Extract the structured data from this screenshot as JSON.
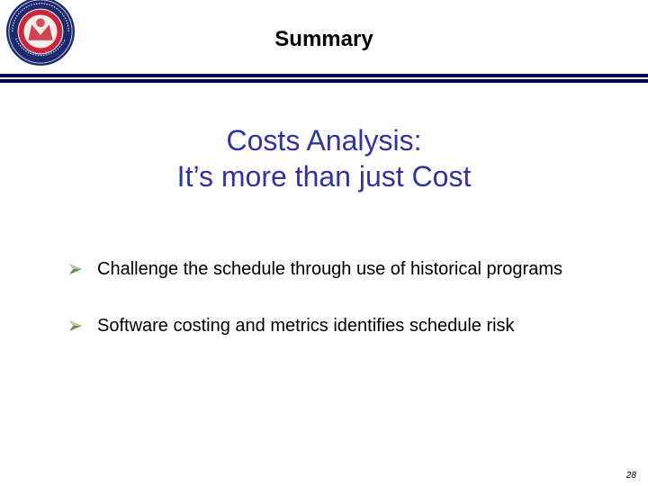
{
  "header": {
    "logo_icon": "army-seal-logo",
    "logo_text": "OFFICE OF THE ASSISTANT SECRETARY OF THE ARMY",
    "title": "Summary"
  },
  "colors": {
    "rule": "#000050",
    "subtitle": "#3333a0",
    "bullet_arrow": "#6f8f4f"
  },
  "slide": {
    "subtitle_line1": "Costs Analysis:",
    "subtitle_line2": "It’s more than just Cost",
    "bullets": [
      {
        "icon": "arrow-bullet-icon",
        "text": "Challenge the schedule through use of historical programs"
      },
      {
        "icon": "arrow-bullet-icon",
        "text": "Software costing and metrics identifies schedule risk"
      }
    ],
    "page_number": "28"
  }
}
